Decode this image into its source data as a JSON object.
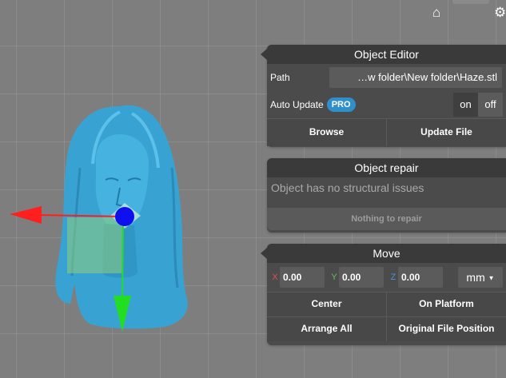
{
  "top_bar": {
    "home_icon": "home-icon",
    "settings_icon": "gear-icon"
  },
  "object_editor": {
    "title": "Object Editor",
    "path_label": "Path",
    "path_value": "…w folder\\New folder\\Haze.stl",
    "auto_update_label": "Auto Update",
    "pro_badge": "PRO",
    "toggle_on": "on",
    "toggle_off": "off",
    "browse_label": "Browse",
    "update_file_label": "Update File"
  },
  "object_repair": {
    "title": "Object repair",
    "message": "Object has no structural issues",
    "repair_button": "Nothing to repair"
  },
  "move": {
    "title": "Move",
    "x_label": "X",
    "x_value": "0.00",
    "y_label": "Y",
    "y_value": "0.00",
    "z_label": "Z",
    "z_value": "0.00",
    "unit": "mm",
    "center_label": "Center",
    "on_platform_label": "On Platform",
    "arrange_all_label": "Arrange All",
    "original_position_label": "Original File Position"
  },
  "colors": {
    "model": "#3aa6d6",
    "gizmo_x": "#ff1f1f",
    "gizmo_y": "#22dd22",
    "gizmo_center": "#1010ee",
    "pro_badge": "#2f8fc8"
  }
}
